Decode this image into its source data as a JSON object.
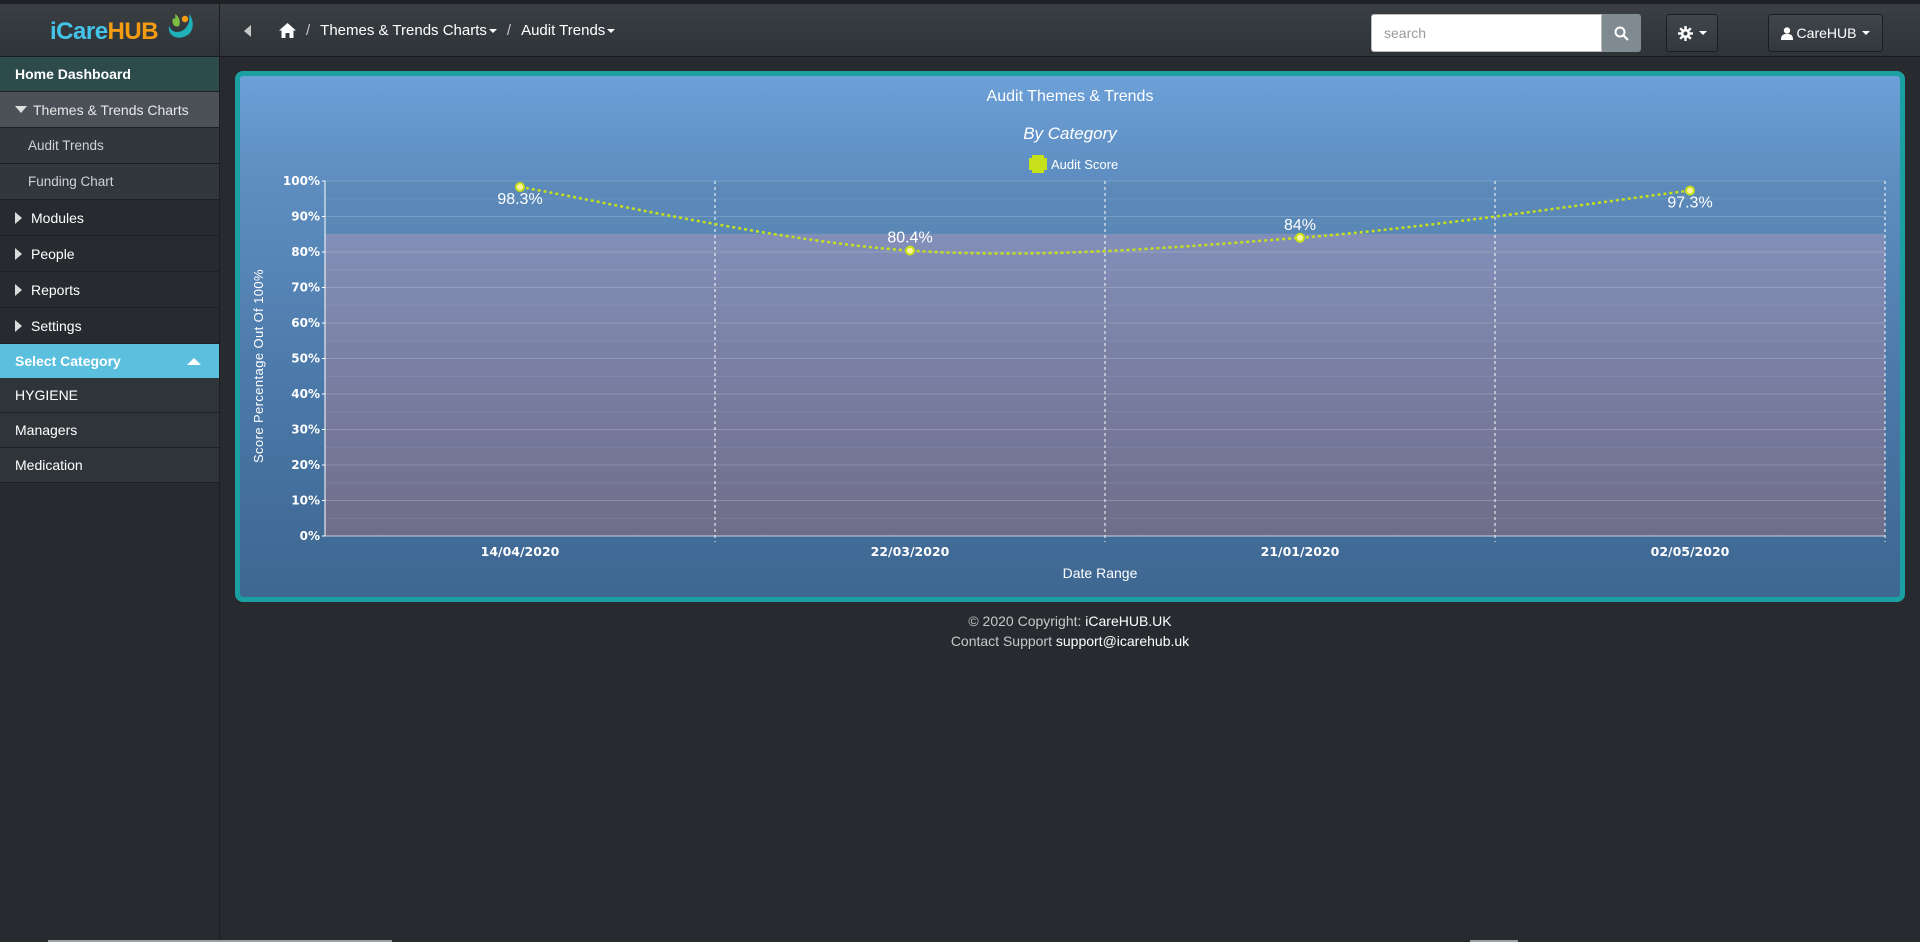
{
  "app": {
    "logo_part1": "iCare",
    "logo_part2": "HUB",
    "brand_colors": {
      "blue": "#44c4e8",
      "orange": "#f39c12",
      "teal": "#1aa0a0"
    }
  },
  "breadcrumb": {
    "home_icon": "home-icon",
    "items": [
      {
        "label": "Themes & Trends Charts"
      },
      {
        "label": "Audit Trends"
      }
    ]
  },
  "search": {
    "placeholder": "search",
    "value": ""
  },
  "user": {
    "name": "CareHUB"
  },
  "sidebar": {
    "home": "Home Dashboard",
    "themes": "Themes & Trends Charts",
    "sub_items": [
      {
        "label": "Audit Trends"
      },
      {
        "label": "Funding Chart"
      }
    ],
    "collapsed": [
      {
        "label": "Modules"
      },
      {
        "label": "People"
      },
      {
        "label": "Reports"
      },
      {
        "label": "Settings"
      }
    ],
    "select_category": "Select Category",
    "categories": [
      {
        "label": "HYGIENE"
      },
      {
        "label": "Managers"
      },
      {
        "label": "Medication"
      }
    ]
  },
  "chart_data": {
    "type": "line",
    "title": "Audit Themes & Trends",
    "subtitle": "By Category",
    "xlabel": "Date Range",
    "ylabel": "Score Percentage Out Of 100%",
    "categories": [
      "14/04/2020",
      "22/03/2020",
      "21/01/2020",
      "02/05/2020"
    ],
    "series": [
      {
        "name": "Audit Score",
        "values": [
          98.3,
          80.4,
          84,
          97.3
        ],
        "labels": [
          "98.3%",
          "80.4%",
          "84%",
          "97.3%"
        ],
        "color": "#c6e01a"
      }
    ],
    "ylim": [
      0,
      100
    ],
    "yticks": [
      "0%",
      "10%",
      "20%",
      "30%",
      "40%",
      "50%",
      "60%",
      "70%",
      "80%",
      "90%",
      "100%"
    ],
    "legend_position": "top-center",
    "grid": true
  },
  "footer": {
    "copyright_prefix": "© 2020 Copyright: ",
    "copyright_link": "iCareHUB.UK",
    "support_prefix": "Contact Support ",
    "support_email": "support@icarehub.uk"
  }
}
